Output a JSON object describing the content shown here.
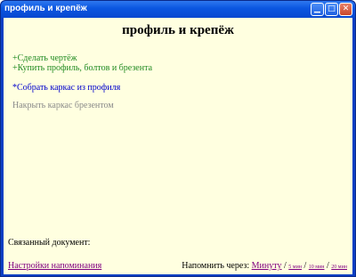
{
  "window": {
    "title": "профиль и крепёж",
    "minimize_glyph": "▁",
    "maximize_glyph": "□",
    "close_glyph": "✕"
  },
  "page": {
    "title": "профиль и крепёж"
  },
  "tasks": [
    {
      "text": "+Сделать чертёж",
      "status": "done",
      "color": "#228b22"
    },
    {
      "text": "+Купить профиль, болтов и брезента",
      "status": "done",
      "color": "#228b22"
    },
    {
      "text": "*Собрать каркас из профиля",
      "status": "active",
      "color": "#0000cc"
    },
    {
      "text": "Накрыть каркас брезентом",
      "status": "todo",
      "color": "#8a8a8a"
    }
  ],
  "footer": {
    "linked_doc_label": "Связанный документ:",
    "settings_link": "Настройки напоминания",
    "remind_label": "Напомнить через:",
    "remind_options": [
      "Минуту",
      "5 мин",
      "10 мин",
      "20 мин"
    ],
    "separator": "/"
  },
  "colors": {
    "background": "#ffffe0",
    "titlebar": "#0a55e0",
    "link": "#800080"
  }
}
